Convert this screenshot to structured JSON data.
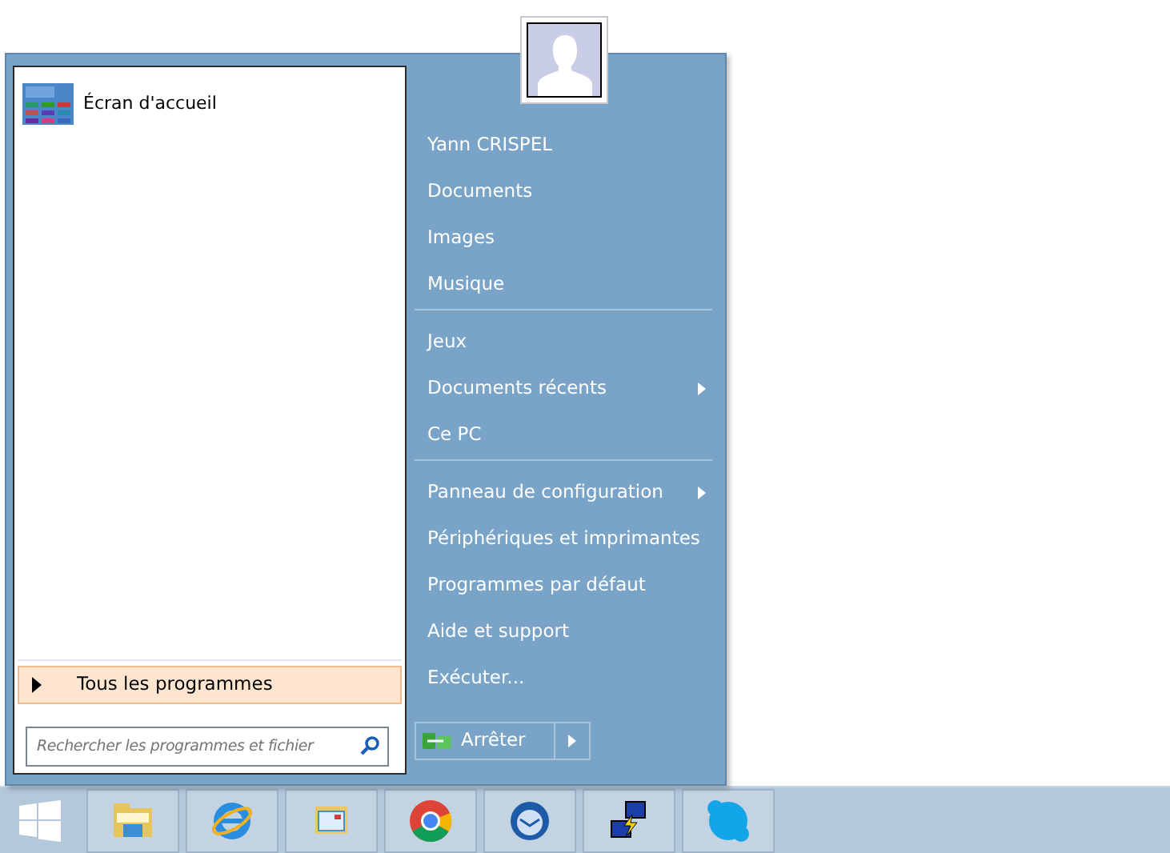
{
  "start_menu": {
    "pinned": [
      {
        "label": "Écran d'accueil",
        "kind": "start-tile"
      }
    ],
    "all_programs": {
      "label": "Tous les programmes"
    },
    "search": {
      "placeholder": "Rechercher les programmes et fichier"
    },
    "user_name": "Yann CRISPEL",
    "right_groups": [
      [
        {
          "label": "Documents",
          "submenu": false
        },
        {
          "label": "Images",
          "submenu": false
        },
        {
          "label": "Musique",
          "submenu": false
        }
      ],
      [
        {
          "label": "Jeux",
          "submenu": false
        },
        {
          "label": "Documents récents",
          "submenu": true
        },
        {
          "label": "Ce PC",
          "submenu": false
        }
      ],
      [
        {
          "label": "Panneau de configuration",
          "submenu": true
        },
        {
          "label": "Périphériques et imprimantes",
          "submenu": false
        },
        {
          "label": "Programmes par défaut",
          "submenu": false
        },
        {
          "label": "Aide et support",
          "submenu": false
        },
        {
          "label": "Exécuter...",
          "submenu": false
        }
      ]
    ],
    "shutdown": {
      "label": "Arrêter"
    }
  },
  "taskbar": {
    "items": [
      {
        "kind": "folder"
      },
      {
        "kind": "browser-e"
      },
      {
        "kind": "window"
      },
      {
        "kind": "chrome"
      },
      {
        "kind": "mail-bird"
      },
      {
        "kind": "network"
      },
      {
        "kind": "skype"
      }
    ]
  }
}
